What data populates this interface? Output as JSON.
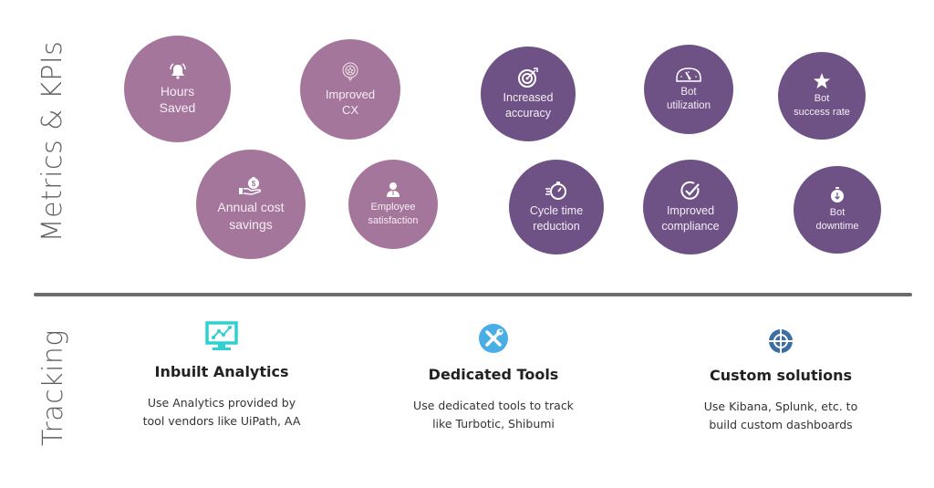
{
  "sections": {
    "metrics_label": "Metrics & KPIs",
    "tracking_label": "Tracking"
  },
  "colors": {
    "metric_light": "#a5769b",
    "metric_dark": "#6e5286",
    "divider": "#6b6b6b",
    "analytics_icon": "#2fd0d0",
    "tools_icon": "#4aaee6",
    "custom_icon": "#3b6ea5"
  },
  "metrics": [
    {
      "line1": "Hours",
      "line2": "Saved",
      "icon": "bell-icon",
      "tone": "light"
    },
    {
      "line1": "Improved",
      "line2": "CX",
      "icon": "star-badge-icon",
      "tone": "light"
    },
    {
      "line1": "Annual cost",
      "line2": "savings",
      "icon": "money-bag-hand-icon",
      "tone": "light"
    },
    {
      "line1": "Employee",
      "line2": "satisfaction",
      "icon": "employee-icon",
      "tone": "light"
    },
    {
      "line1": "Increased",
      "line2": "accuracy",
      "icon": "target-icon",
      "tone": "dark"
    },
    {
      "line1": "Bot",
      "line2": "utilization",
      "icon": "speedometer-icon",
      "tone": "dark"
    },
    {
      "line1": "Bot",
      "line2": "success rate",
      "icon": "star-icon",
      "tone": "dark"
    },
    {
      "line1": "Cycle time",
      "line2": "reduction",
      "icon": "stopwatch-icon",
      "tone": "dark"
    },
    {
      "line1": "Improved",
      "line2": "compliance",
      "icon": "check-circle-icon",
      "tone": "dark"
    },
    {
      "line1": "Bot",
      "line2": "downtime",
      "icon": "timer-down-icon",
      "tone": "dark"
    }
  ],
  "tracking": [
    {
      "title": "Inbuilt Analytics",
      "desc1": "Use Analytics provided by",
      "desc2": "tool vendors like UiPath, AA",
      "icon": "monitor-chart-icon"
    },
    {
      "title": "Dedicated Tools",
      "desc1": "Use dedicated tools to track",
      "desc2": "like Turbotic, Shibumi",
      "icon": "tools-icon"
    },
    {
      "title": "Custom solutions",
      "desc1": "Use Kibana, Splunk, etc. to",
      "desc2": "build custom dashboards",
      "icon": "crosshair-icon"
    }
  ]
}
